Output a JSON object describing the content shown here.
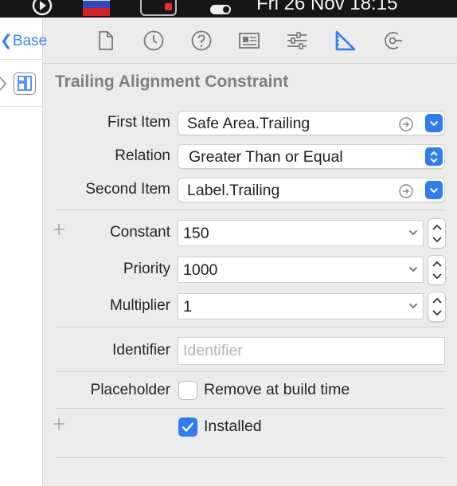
{
  "menubar": {
    "clock": "Fri 26 Nov  18:15"
  },
  "navigator": {
    "breadcrumb": "❮Base"
  },
  "inspector": {
    "tabs": [
      {
        "name": "file-inspector",
        "active": false
      },
      {
        "name": "history-inspector",
        "active": false
      },
      {
        "name": "quick-help-inspector",
        "active": false
      },
      {
        "name": "identity-inspector",
        "active": false
      },
      {
        "name": "attributes-inspector",
        "active": false
      },
      {
        "name": "size-inspector",
        "active": true
      },
      {
        "name": "connections-inspector",
        "active": false
      }
    ],
    "title": "Trailing Alignment Constraint",
    "first_item": {
      "label": "First Item",
      "value": "Safe Area.Trailing"
    },
    "relation": {
      "label": "Relation",
      "value": "Greater Than or Equal"
    },
    "second_item": {
      "label": "Second Item",
      "value": "Label.Trailing"
    },
    "constant": {
      "label": "Constant",
      "value": "150"
    },
    "priority": {
      "label": "Priority",
      "value": "1000"
    },
    "multiplier": {
      "label": "Multiplier",
      "value": "1"
    },
    "identifier": {
      "label": "Identifier",
      "placeholder": "Identifier",
      "value": ""
    },
    "placeholder": {
      "label": "Placeholder",
      "checkbox_label": "Remove at build time",
      "checked": false
    },
    "installed": {
      "checkbox_label": "Installed",
      "checked": true
    }
  },
  "colors": {
    "accent": "#2e7cf6",
    "panel_bg": "#ececec",
    "title_gray": "#808080"
  }
}
